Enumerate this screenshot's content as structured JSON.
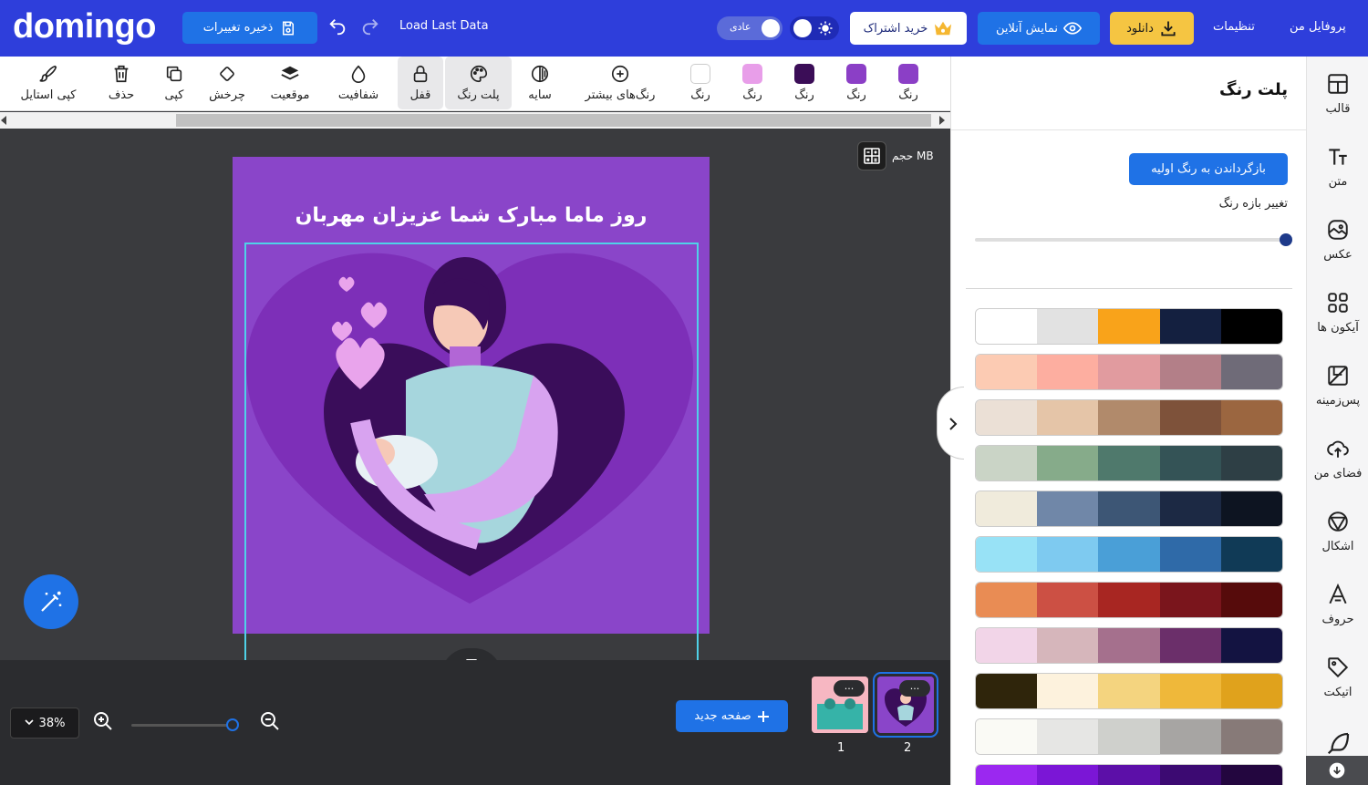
{
  "app": {
    "logo": "domingo"
  },
  "header": {
    "save_label": "ذخیره تغییرات",
    "load_last": "Load Last Data",
    "mode_label": "عادی",
    "subscribe_label": "خرید اشتراک",
    "live_label": "نمایش آنلاین",
    "download_label": "دانلود",
    "settings_label": "تنظیمات",
    "profile_label": "پروفایل من"
  },
  "toolbar": {
    "copy_style": "کپی استایل",
    "delete": "حذف",
    "copy": "کپی",
    "rotate": "چرخش",
    "position": "موقعیت",
    "opacity": "شفافیت",
    "lock": "قفل",
    "palette": "پلت رنگ",
    "shadow": "سایه",
    "more_colors": "رنگ‌های بیشتر",
    "colors": [
      {
        "label": "رنگ",
        "hex": "#ffffff"
      },
      {
        "label": "رنگ",
        "hex": "#e89ee9"
      },
      {
        "label": "رنگ",
        "hex": "#3b0d57"
      },
      {
        "label": "رنگ",
        "hex": "#8b3fc6"
      },
      {
        "label": "رنگ",
        "hex": "#8b3fc6"
      }
    ]
  },
  "canvas": {
    "size_label": "حجم MB",
    "design_title": "روز ماما مبارک شما عزیزان مهربان",
    "bg_color": "#8a45c9"
  },
  "bottom": {
    "zoom": "38%",
    "new_page": "صفحه جدید",
    "pages": [
      {
        "num": "1",
        "dots": "..."
      },
      {
        "num": "2",
        "dots": "..."
      }
    ]
  },
  "panel": {
    "title": "پلت رنگ",
    "reset_label": "بازگرداندن به رنگ اولیه",
    "range_label": "تغییر بازه رنگ",
    "range_value": 1.0,
    "palettes": [
      [
        "#ffffff",
        "#e2e2e2",
        "#f9a31a",
        "#142040",
        "#000000"
      ],
      [
        "#fccbb3",
        "#fdaea0",
        "#e19b9f",
        "#b37f88",
        "#6f6b78"
      ],
      [
        "#ebe0d6",
        "#e5c5a8",
        "#b18a6b",
        "#7e523a",
        "#9b6640"
      ],
      [
        "#cad4c6",
        "#86ab8a",
        "#4f796c",
        "#345356",
        "#2e3f45"
      ],
      [
        "#f0ebdc",
        "#7087a8",
        "#3d5675",
        "#1c2944",
        "#0d1421"
      ],
      [
        "#98e2f6",
        "#7ecaf0",
        "#4a9fd7",
        "#2f6aa8",
        "#103a56"
      ],
      [
        "#e98c54",
        "#cc5044",
        "#a82622",
        "#7a151c",
        "#560b0b"
      ],
      [
        "#f2d5e8",
        "#d6b6bb",
        "#a5708d",
        "#6b2f6a",
        "#131341"
      ],
      [
        "#2f250b",
        "#fdf2dd",
        "#f4d47f",
        "#efb83a",
        "#e0a21c"
      ],
      [
        "#fafaf5",
        "#e6e6e4",
        "#cfd0cc",
        "#a7a5a3",
        "#877a78"
      ],
      [
        "#9b28f0",
        "#7b16d6",
        "#5c0fa8",
        "#3c0a72",
        "#23063f"
      ]
    ]
  },
  "sidenav": {
    "items": [
      {
        "label": "قالب",
        "icon": "template-icon"
      },
      {
        "label": "متن",
        "icon": "text-icon"
      },
      {
        "label": "عکس",
        "icon": "image-icon"
      },
      {
        "label": "آیکون ها",
        "icon": "icons-icon"
      },
      {
        "label": "پس‌زمینه",
        "icon": "background-icon"
      },
      {
        "label": "فضای من",
        "icon": "cloud-upload-icon"
      },
      {
        "label": "اشکال",
        "icon": "shapes-icon"
      },
      {
        "label": "حروف",
        "icon": "letters-icon"
      },
      {
        "label": "اتیکت",
        "icon": "tag-icon"
      }
    ]
  }
}
